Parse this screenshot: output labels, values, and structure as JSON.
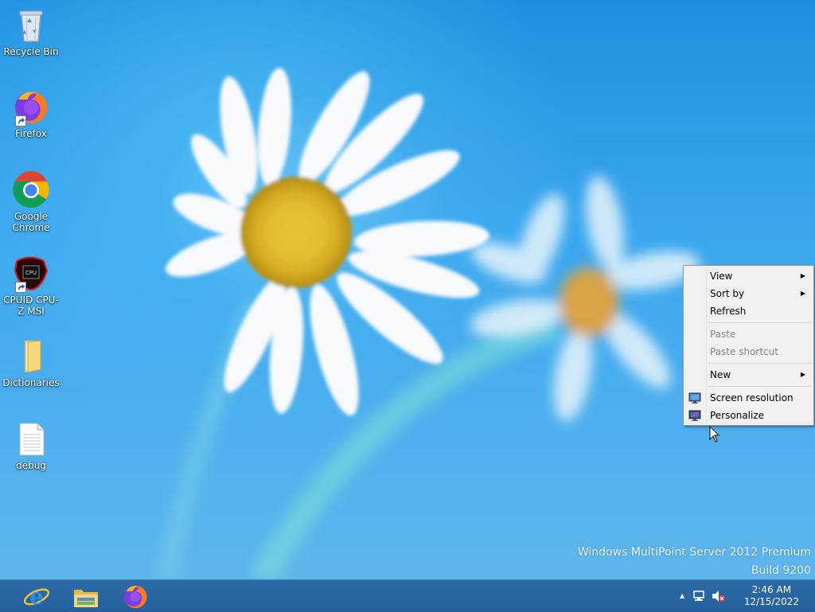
{
  "desktop_icons": [
    {
      "label": "Recycle Bin",
      "icon": "recycle-bin-icon"
    },
    {
      "label": "Firefox",
      "icon": "firefox-icon"
    },
    {
      "label": "Google Chrome",
      "icon": "chrome-icon"
    },
    {
      "label": "CPUID CPU-Z MSI",
      "icon": "cpuz-icon"
    },
    {
      "label": "Dictionaries",
      "icon": "folder-icon"
    },
    {
      "label": "debug",
      "icon": "text-file-icon"
    }
  ],
  "context_menu": {
    "items": [
      {
        "label": "View",
        "has_submenu": true,
        "enabled": true
      },
      {
        "label": "Sort by",
        "has_submenu": true,
        "enabled": true
      },
      {
        "label": "Refresh",
        "has_submenu": false,
        "enabled": true
      },
      {
        "label": "Paste",
        "has_submenu": false,
        "enabled": false
      },
      {
        "label": "Paste shortcut",
        "has_submenu": false,
        "enabled": false
      },
      {
        "label": "New",
        "has_submenu": true,
        "enabled": true
      },
      {
        "label": "Screen resolution",
        "has_submenu": false,
        "enabled": true,
        "icon": "screen-resolution-icon"
      },
      {
        "label": "Personalize",
        "has_submenu": false,
        "enabled": true,
        "icon": "personalize-icon"
      }
    ],
    "submenu_glyph": "▶"
  },
  "watermark": {
    "line1": "Windows MultiPoint Server 2012 Premium",
    "line2": "Build 9200"
  },
  "taskbar": {
    "pinned": [
      "internet-explorer-icon",
      "file-explorer-icon",
      "firefox-icon"
    ],
    "tray": {
      "overflow_glyph": "▲",
      "icons": [
        "network-icon",
        "volume-muted-icon"
      ],
      "time": "2:46 AM",
      "date": "12/15/2022"
    }
  },
  "colors": {
    "taskbar": "#24609e",
    "desktop": "#3aa6ee",
    "menu_bg": "#f0f0f0",
    "menu_disabled_text": "#838383"
  }
}
